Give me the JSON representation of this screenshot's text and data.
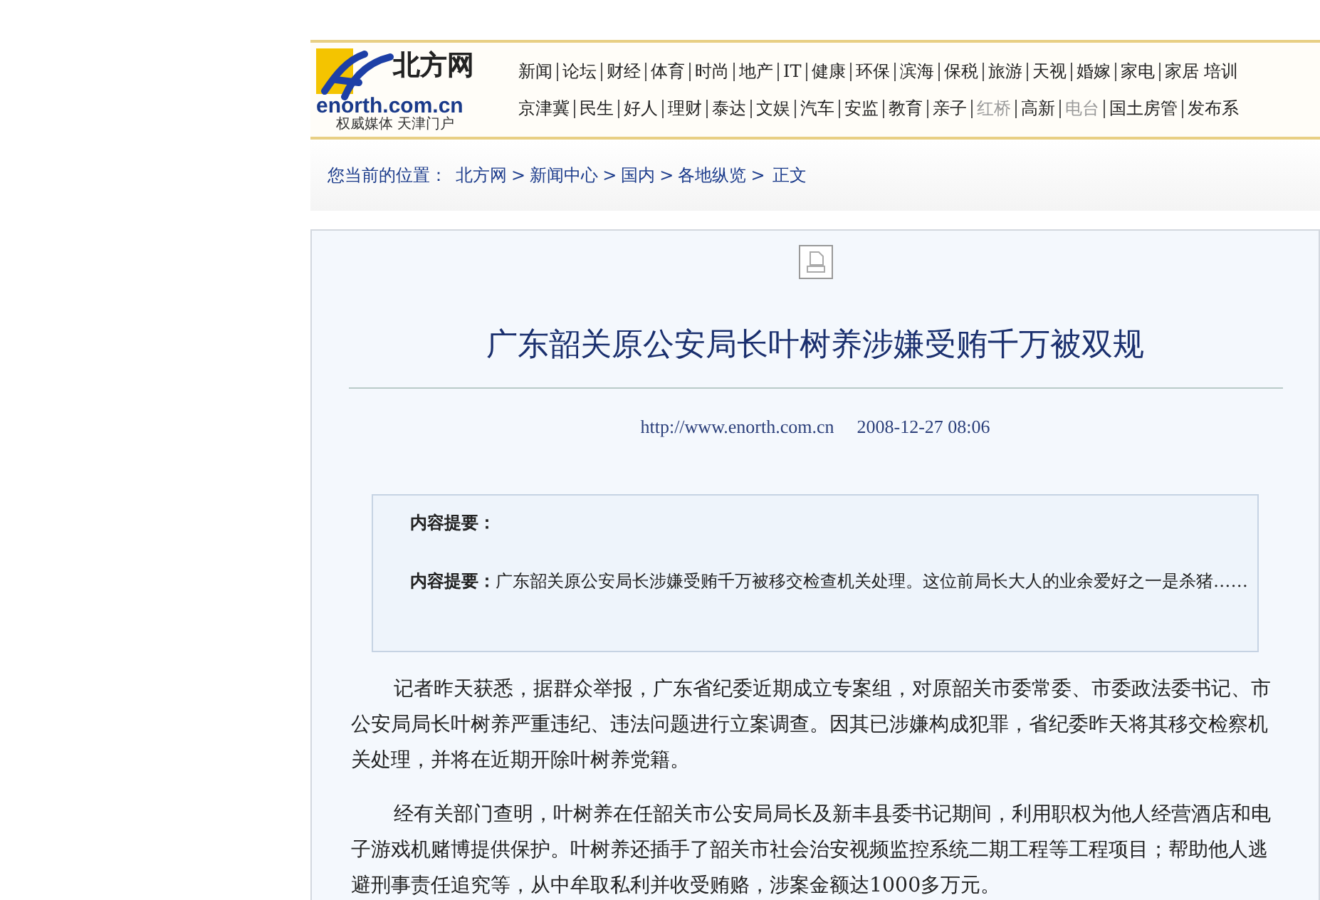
{
  "logo": {
    "name": "北方网",
    "domain": "enorth.com.cn",
    "slogan": "权威媒体 天津门户"
  },
  "nav_rows": [
    [
      {
        "label": "新闻",
        "dimmed": false
      },
      {
        "label": "论坛",
        "dimmed": false
      },
      {
        "label": "财经",
        "dimmed": false
      },
      {
        "label": "体育",
        "dimmed": false
      },
      {
        "label": "时尚",
        "dimmed": false
      },
      {
        "label": "地产",
        "dimmed": false
      },
      {
        "label": "IT",
        "dimmed": false
      },
      {
        "label": "健康",
        "dimmed": false
      },
      {
        "label": "环保",
        "dimmed": false
      },
      {
        "label": "滨海",
        "dimmed": false
      },
      {
        "label": "保税",
        "dimmed": false
      },
      {
        "label": "旅游",
        "dimmed": false
      },
      {
        "label": "天视",
        "dimmed": false
      },
      {
        "label": "婚嫁",
        "dimmed": false
      },
      {
        "label": "家电",
        "dimmed": false
      },
      {
        "label": "家居 培训",
        "dimmed": false
      }
    ],
    [
      {
        "label": "京津冀",
        "dimmed": false
      },
      {
        "label": "民生",
        "dimmed": false
      },
      {
        "label": "好人",
        "dimmed": false
      },
      {
        "label": "理财",
        "dimmed": false
      },
      {
        "label": "泰达",
        "dimmed": false
      },
      {
        "label": "文娱",
        "dimmed": false
      },
      {
        "label": "汽车",
        "dimmed": false
      },
      {
        "label": "安监",
        "dimmed": false
      },
      {
        "label": "教育",
        "dimmed": false
      },
      {
        "label": "亲子",
        "dimmed": false
      },
      {
        "label": "红桥",
        "dimmed": true
      },
      {
        "label": "高新",
        "dimmed": false
      },
      {
        "label": "电台",
        "dimmed": true
      },
      {
        "label": "国土房管",
        "dimmed": false
      },
      {
        "label": "发布系",
        "dimmed": false
      }
    ]
  ],
  "breadcrumb": {
    "label": "您当前的位置：",
    "separator": ">",
    "items": [
      "北方网",
      "新闻中心",
      "国内",
      "各地纵览"
    ],
    "current": "正文"
  },
  "article": {
    "title": "广东韶关原公安局长叶树养涉嫌受贿千万被双规",
    "source": "http://www.enorth.com.cn",
    "date": "2008-12-27 08:06",
    "summary": {
      "heading": "内容提要：",
      "label": "内容提要：",
      "text": "广东韶关原公安局长涉嫌受贿千万被移交检查机关处理。这位前局长大人的业余爱好之一是杀猪……"
    },
    "paragraphs": [
      "记者昨天获悉，据群众举报，广东省纪委近期成立专案组，对原韶关市委常委、市委政法委书记、市公安局局长叶树养严重违纪、违法问题进行立案调查。因其已涉嫌构成犯罪，省纪委昨天将其移交检察机关处理，并将在近期开除叶树养党籍。",
      "经有关部门查明，叶树养在任韶关市公安局局长及新丰县委书记期间，利用职权为他人经营酒店和电子游戏机赌博提供保护。叶树养还插手了韶关市社会治安视频监控系统二期工程等工程项目；帮助他人逃避刑事责任追究等，从中牟取私利并收受贿赂，涉案金额达1000多万元。"
    ]
  }
}
